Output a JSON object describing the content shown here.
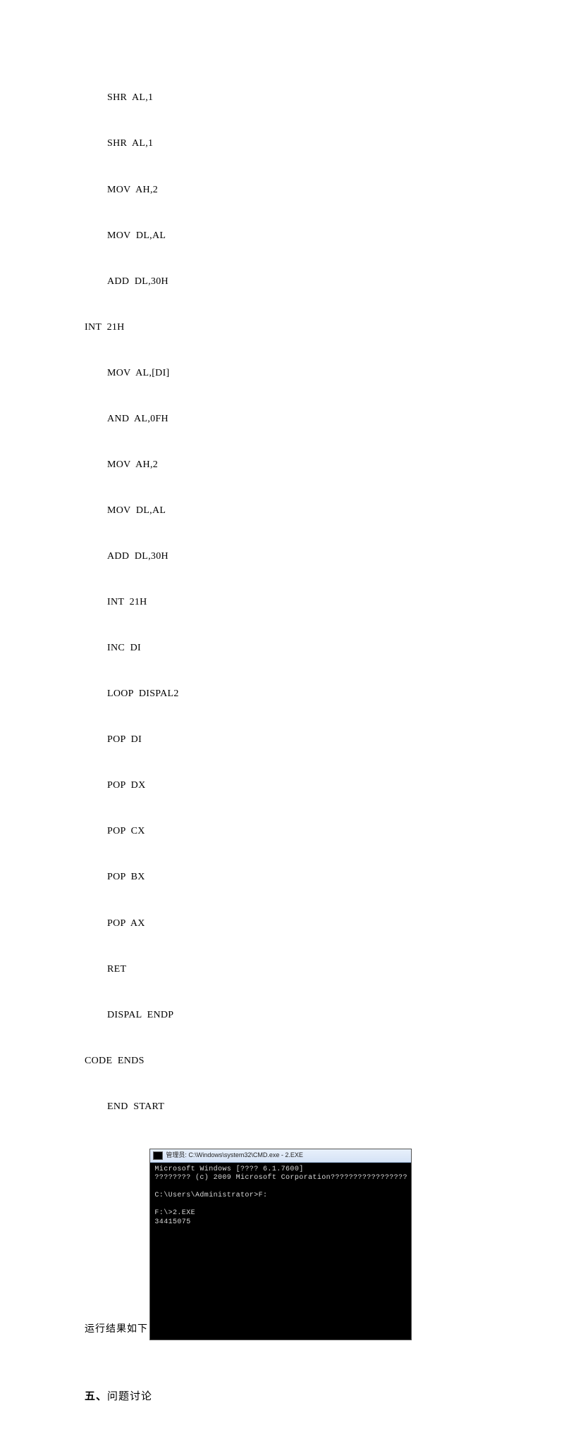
{
  "code": {
    "lines": [
      {
        "indent": 1,
        "text": "SHR  AL,1"
      },
      {
        "indent": 1,
        "text": "SHR  AL,1"
      },
      {
        "indent": 1,
        "text": "MOV  AH,2"
      },
      {
        "indent": 1,
        "text": "MOV  DL,AL"
      },
      {
        "indent": 1,
        "text": "ADD  DL,30H"
      },
      {
        "indent": 0,
        "text": "INT  21H"
      },
      {
        "indent": 1,
        "text": "MOV  AL,[DI]"
      },
      {
        "indent": 1,
        "text": "AND  AL,0FH"
      },
      {
        "indent": 1,
        "text": "MOV  AH,2"
      },
      {
        "indent": 1,
        "text": "MOV  DL,AL"
      },
      {
        "indent": 1,
        "text": "ADD  DL,30H"
      },
      {
        "indent": 1,
        "text": "INT  21H"
      },
      {
        "indent": 1,
        "text": "INC  DI"
      },
      {
        "indent": 1,
        "text": "LOOP  DISPAL2"
      },
      {
        "indent": 1,
        "text": "POP  DI"
      },
      {
        "indent": 1,
        "text": "POP  DX"
      },
      {
        "indent": 1,
        "text": "POP  CX"
      },
      {
        "indent": 1,
        "text": "POP  BX"
      },
      {
        "indent": 1,
        "text": "POP  AX"
      },
      {
        "indent": 1,
        "text": "RET"
      },
      {
        "indent": 1,
        "text": "DISPAL  ENDP"
      },
      {
        "indent": 0,
        "text": "CODE  ENDS"
      },
      {
        "indent": 1,
        "text": "END  START"
      }
    ]
  },
  "result_label": "运行结果如下 :",
  "cmd": {
    "title": "管理员: C:\\Windows\\system32\\CMD.exe - 2.EXE",
    "line1": "Microsoft Windows [???? 6.1.7600]",
    "line2": "???????? (c) 2009 Microsoft Corporation?????????????????",
    "line3": "C:\\Users\\Administrator>F:",
    "line4": "F:\\>2.EXE",
    "line5": "34415075"
  },
  "section5": {
    "num": "五、",
    "title": "问题讨论"
  }
}
